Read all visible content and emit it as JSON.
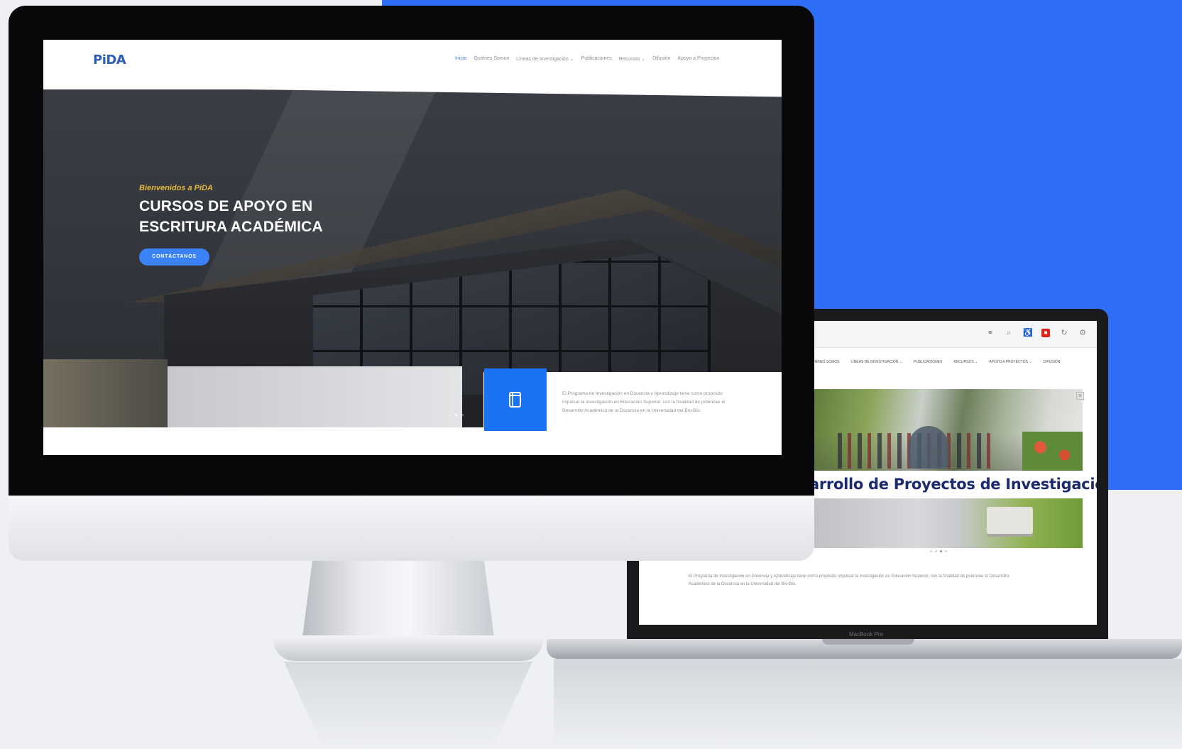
{
  "imac": {
    "logo": "PiDA",
    "nav": [
      "Inicio",
      "Quiénes Somos",
      "Líneas de Investigación ⌄",
      "Publicaciones",
      "Recursos ⌄",
      "Difusión",
      "Apoyo a Proyectos"
    ],
    "hero": {
      "tagline": "Bienvenidos a PiDA",
      "title_line1": "CURSOS DE APOYO EN",
      "title_line2": "ESCRITURA ACADÉMICA",
      "button": "CONTÁCTANOS",
      "slide_count": 4,
      "active_slide": 3
    },
    "info": {
      "icon": "book-icon",
      "text": "El Programa de Investigación en Docencia y Aprendizaje tiene como propósito impulsar la investigación en Educación Superior, con la finalidad de potenciar el Desarrollo Académico de la Docencia en la Universidad del Bío-Bío."
    }
  },
  "laptop": {
    "brand": "MacBook Pro",
    "toolbar_icons": [
      "user-icon",
      "search-icon",
      "accessibility-icon",
      "pdf-icon",
      "refresh-icon",
      "settings-icon"
    ],
    "nav": [
      "QUIÉNES SOMOS",
      "LÍNEAS DE INVESTIGACIÓN ⌄",
      "PUBLICACIONES",
      "RECURSOS ⌄",
      "APOYO A PROYECTOS ⌄",
      "DIFUSIÓN"
    ],
    "heading": "arrollo de Proyectos de Investigación",
    "body": "El Programa de Investigación en Docencia y Aprendizaje tiene como propósito impulsar la investigación en Educación Superior, con la finalidad de potenciar el Desarrollo Académico de la Docencia en la Universidad del Bío-Bío."
  },
  "colors": {
    "brand_blue": "#2f6ff6",
    "button_blue": "#3b82f6",
    "tagline_gold": "#e6b93a",
    "heading_navy": "#1c2a6e"
  }
}
